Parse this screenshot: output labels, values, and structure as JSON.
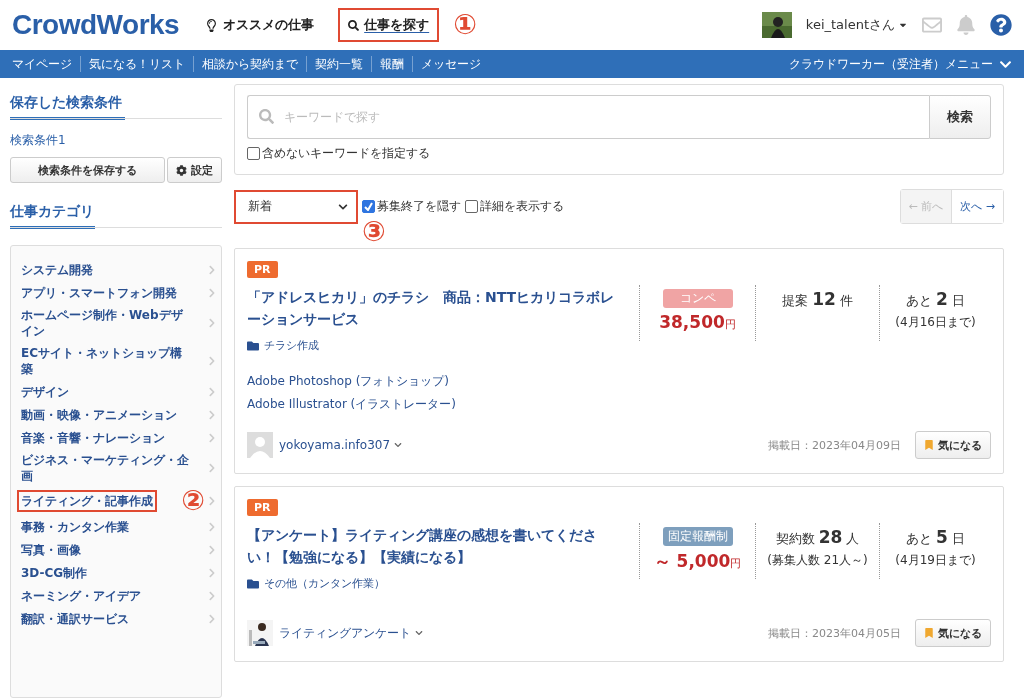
{
  "header": {
    "logo": "CrowdWorks",
    "links": [
      {
        "label": "オススメの仕事",
        "highlighted": false
      },
      {
        "label": "仕事を探す",
        "highlighted": true,
        "callout": "①"
      }
    ],
    "user": {
      "name": "kei_talentさん"
    }
  },
  "nav": {
    "items": [
      "マイページ",
      "気になる！リスト",
      "相談から契約まで",
      "契約一覧",
      "報酬",
      "メッセージ"
    ],
    "menu": "クラウドワーカー（受注者）メニュー"
  },
  "sidebar": {
    "saved_title": "保存した検索条件",
    "saved_items": [
      "検索条件1"
    ],
    "save_button": "検索条件を保存する",
    "settings_button": "設定",
    "category_title": "仕事カテゴリ",
    "categories": [
      {
        "label": "システム開発",
        "highlighted": false
      },
      {
        "label": "アプリ・スマートフォン開発",
        "highlighted": false
      },
      {
        "label": "ホームページ制作・Webデザイン",
        "highlighted": false
      },
      {
        "label": "ECサイト・ネットショップ構築",
        "highlighted": false
      },
      {
        "label": "デザイン",
        "highlighted": false
      },
      {
        "label": "動画・映像・アニメーション",
        "highlighted": false
      },
      {
        "label": "音楽・音響・ナレーション",
        "highlighted": false
      },
      {
        "label": "ビジネス・マーケティング・企画",
        "highlighted": false
      },
      {
        "label": "ライティング・記事作成",
        "highlighted": true,
        "callout": "②"
      },
      {
        "label": "事務・カンタン作業",
        "highlighted": false
      },
      {
        "label": "写真・画像",
        "highlighted": false
      },
      {
        "label": "3D-CG制作",
        "highlighted": false
      },
      {
        "label": "ネーミング・アイデア",
        "highlighted": false
      },
      {
        "label": "翻訳・通訳サービス",
        "highlighted": false
      }
    ]
  },
  "search": {
    "placeholder": "キーワードで探す",
    "button": "検索",
    "exclude": {
      "label": "含めないキーワードを指定する",
      "checked": false
    }
  },
  "filters": {
    "sort": {
      "value": "新着",
      "highlighted": true,
      "callout": "③"
    },
    "options": [
      {
        "label": "募集終了を隠す",
        "checked": true
      },
      {
        "label": "詳細を表示する",
        "checked": false
      }
    ],
    "prev": {
      "label": "← 前へ",
      "disabled": true
    },
    "next": {
      "label": "次へ →",
      "disabled": false
    }
  },
  "jobs": [
    {
      "badge": "PR",
      "title": "「アドレスヒカリ」のチラシ　商品：NTTヒカリコラボレーションサービス",
      "category": "チラシ作成",
      "skills": [
        "Adobe Photoshop (フォトショップ)",
        "Adobe Illustrator (イラストレーター)"
      ],
      "type": {
        "kind": "compe",
        "label": "コンペ"
      },
      "price": "38,500",
      "currency": "円",
      "count_label": "提案",
      "count": "12",
      "count_unit": "件",
      "deadline_prefix": "あと",
      "deadline": "2",
      "deadline_unit": "日",
      "deadline_note": "(4月16日まで)",
      "client": {
        "name": "yokoyama.info307"
      },
      "posted": "掲載日：2023年04月09日",
      "bookmark": "気になる"
    },
    {
      "badge": "PR",
      "title": "【アンケート】ライティング講座の感想を書いてください！【勉強になる】【実績になる】",
      "category": "その他（カンタン作業）",
      "type": {
        "kind": "fixed",
        "label": "固定報酬制"
      },
      "price_prefix": "～",
      "price": "5,000",
      "currency": "円",
      "count_label": "契約数",
      "count": "28",
      "count_unit": "人",
      "count_note": "(募集人数 21人～)",
      "deadline_prefix": "あと",
      "deadline": "5",
      "deadline_unit": "日",
      "deadline_note": "(4月19日まで)",
      "client": {
        "name": "ライティングアンケート"
      },
      "posted": "掲載日：2023年04月05日",
      "bookmark": "気になる"
    }
  ]
}
